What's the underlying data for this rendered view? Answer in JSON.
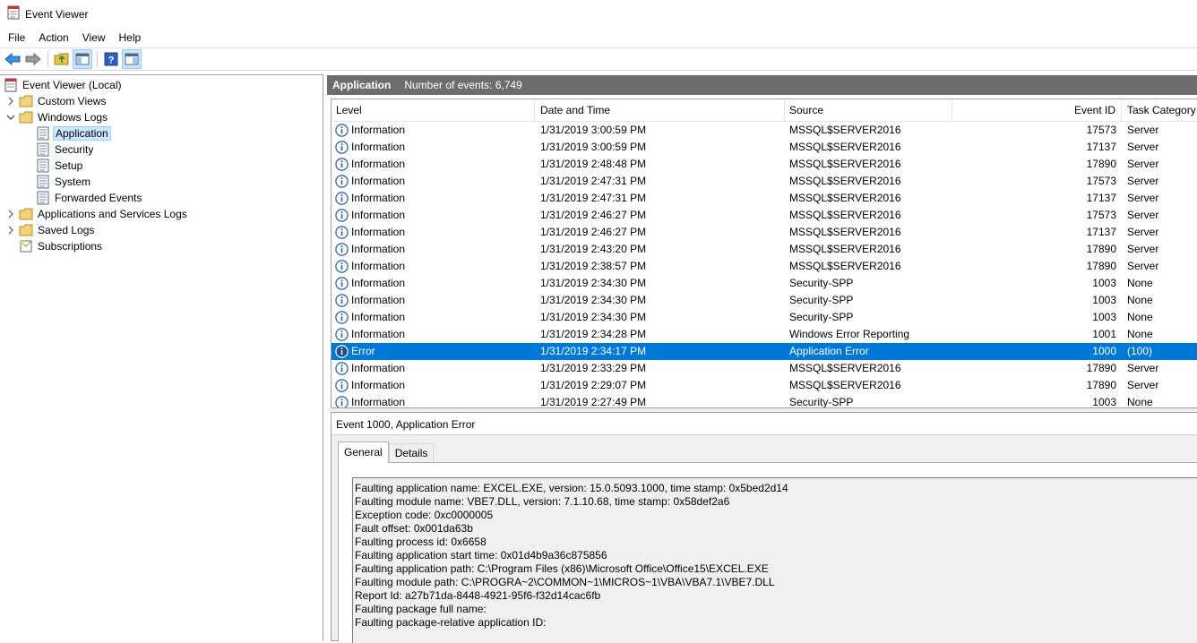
{
  "window": {
    "title": "Event Viewer"
  },
  "menu": [
    "File",
    "Action",
    "View",
    "Help"
  ],
  "toolbar": [
    "back-icon",
    "forward-icon",
    "folder-up-icon",
    "show-hide-tree-icon",
    "help-icon",
    "show-hide-action-pane-icon"
  ],
  "tree": {
    "root": "Event Viewer (Local)",
    "custom_views": "Custom Views",
    "windows_logs": "Windows Logs",
    "application": "Application",
    "security": "Security",
    "setup": "Setup",
    "system": "System",
    "forwarded": "Forwarded Events",
    "app_services": "Applications and Services Logs",
    "saved_logs": "Saved Logs",
    "subscriptions": "Subscriptions"
  },
  "log_header": {
    "name": "Application",
    "count": "Number of events: 6,749"
  },
  "columns": {
    "level": "Level",
    "date": "Date and Time",
    "source": "Source",
    "event_id": "Event ID",
    "category": "Task Category"
  },
  "rows": [
    {
      "level": "Information",
      "date": "1/31/2019 3:00:59 PM",
      "source": "MSSQL$SERVER2016",
      "id": "17573",
      "cat": "Server"
    },
    {
      "level": "Information",
      "date": "1/31/2019 3:00:59 PM",
      "source": "MSSQL$SERVER2016",
      "id": "17137",
      "cat": "Server"
    },
    {
      "level": "Information",
      "date": "1/31/2019 2:48:48 PM",
      "source": "MSSQL$SERVER2016",
      "id": "17890",
      "cat": "Server"
    },
    {
      "level": "Information",
      "date": "1/31/2019 2:47:31 PM",
      "source": "MSSQL$SERVER2016",
      "id": "17573",
      "cat": "Server"
    },
    {
      "level": "Information",
      "date": "1/31/2019 2:47:31 PM",
      "source": "MSSQL$SERVER2016",
      "id": "17137",
      "cat": "Server"
    },
    {
      "level": "Information",
      "date": "1/31/2019 2:46:27 PM",
      "source": "MSSQL$SERVER2016",
      "id": "17573",
      "cat": "Server"
    },
    {
      "level": "Information",
      "date": "1/31/2019 2:46:27 PM",
      "source": "MSSQL$SERVER2016",
      "id": "17137",
      "cat": "Server"
    },
    {
      "level": "Information",
      "date": "1/31/2019 2:43:20 PM",
      "source": "MSSQL$SERVER2016",
      "id": "17890",
      "cat": "Server"
    },
    {
      "level": "Information",
      "date": "1/31/2019 2:38:57 PM",
      "source": "MSSQL$SERVER2016",
      "id": "17890",
      "cat": "Server"
    },
    {
      "level": "Information",
      "date": "1/31/2019 2:34:30 PM",
      "source": "Security-SPP",
      "id": "1003",
      "cat": "None"
    },
    {
      "level": "Information",
      "date": "1/31/2019 2:34:30 PM",
      "source": "Security-SPP",
      "id": "1003",
      "cat": "None"
    },
    {
      "level": "Information",
      "date": "1/31/2019 2:34:30 PM",
      "source": "Security-SPP",
      "id": "1003",
      "cat": "None"
    },
    {
      "level": "Information",
      "date": "1/31/2019 2:34:28 PM",
      "source": "Windows Error Reporting",
      "id": "1001",
      "cat": "None"
    },
    {
      "level": "Error",
      "date": "1/31/2019 2:34:17 PM",
      "source": "Application Error",
      "id": "1000",
      "cat": "(100)",
      "selected": true
    },
    {
      "level": "Information",
      "date": "1/31/2019 2:33:29 PM",
      "source": "MSSQL$SERVER2016",
      "id": "17890",
      "cat": "Server"
    },
    {
      "level": "Information",
      "date": "1/31/2019 2:29:07 PM",
      "source": "MSSQL$SERVER2016",
      "id": "17890",
      "cat": "Server"
    },
    {
      "level": "Information",
      "date": "1/31/2019 2:27:49 PM",
      "source": "Security-SPP",
      "id": "1003",
      "cat": "None"
    }
  ],
  "detail": {
    "title": "Event 1000, Application Error",
    "tabs": [
      "General",
      "Details"
    ],
    "lines": [
      "Faulting application name: EXCEL.EXE, version: 15.0.5093.1000, time stamp: 0x5bed2d14",
      "Faulting module name: VBE7.DLL, version: 7.1.10.68, time stamp: 0x58def2a6",
      "Exception code: 0xc0000005",
      "Fault offset: 0x001da63b",
      "Faulting process id: 0x6658",
      "Faulting application start time: 0x01d4b9a36c875856",
      "Faulting application path: C:\\Program Files (x86)\\Microsoft Office\\Office15\\EXCEL.EXE",
      "Faulting module path: C:\\PROGRA~2\\COMMON~1\\MICROS~1\\VBA\\VBA7.1\\VBE7.DLL",
      "Report Id: a27b71da-8448-4921-95f6-f32d14cac6fb",
      "Faulting package full name: ",
      "Faulting package-relative application ID: "
    ]
  },
  "colors": {
    "selection": "#0078d7",
    "header_bar": "#6d6d6d",
    "info_icon": "#1f5fa8"
  }
}
